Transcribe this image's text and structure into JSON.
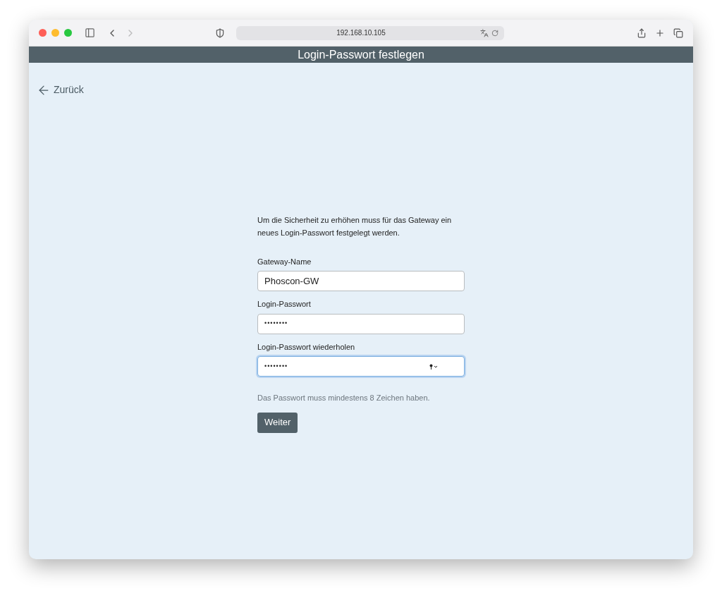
{
  "browser": {
    "address": "192.168.10.105"
  },
  "header": {
    "title": "Login-Passwort festlegen"
  },
  "back_link": {
    "label": "Zurück"
  },
  "intro": "Um die Sicherheit zu erhöhen muss für das Gateway ein neues Login-Passwort festgelegt werden.",
  "fields": [
    {
      "label": "Gateway-Name",
      "kind": "text",
      "value": "Phoscon-GW",
      "focused": false
    },
    {
      "label": "Login-Passwort",
      "kind": "password",
      "value": "••••••••",
      "focused": false
    },
    {
      "label": "Login-Passwort wiederholen",
      "kind": "password",
      "value": "••••••••",
      "focused": true
    }
  ],
  "hint": "Das Passwort muss mindestens 8 Zeichen haben.",
  "submit_button": {
    "label": "Weiter"
  }
}
